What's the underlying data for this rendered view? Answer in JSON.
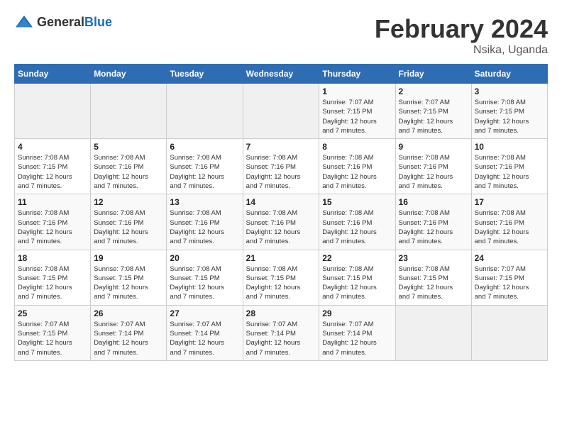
{
  "header": {
    "logo_general": "General",
    "logo_blue": "Blue",
    "title": "February 2024",
    "location": "Nsika, Uganda"
  },
  "days_of_week": [
    "Sunday",
    "Monday",
    "Tuesday",
    "Wednesday",
    "Thursday",
    "Friday",
    "Saturday"
  ],
  "weeks": [
    [
      {
        "day": "",
        "info": ""
      },
      {
        "day": "",
        "info": ""
      },
      {
        "day": "",
        "info": ""
      },
      {
        "day": "",
        "info": ""
      },
      {
        "day": "1",
        "info": "Sunrise: 7:07 AM\nSunset: 7:15 PM\nDaylight: 12 hours\nand 7 minutes."
      },
      {
        "day": "2",
        "info": "Sunrise: 7:07 AM\nSunset: 7:15 PM\nDaylight: 12 hours\nand 7 minutes."
      },
      {
        "day": "3",
        "info": "Sunrise: 7:08 AM\nSunset: 7:15 PM\nDaylight: 12 hours\nand 7 minutes."
      }
    ],
    [
      {
        "day": "4",
        "info": "Sunrise: 7:08 AM\nSunset: 7:15 PM\nDaylight: 12 hours\nand 7 minutes."
      },
      {
        "day": "5",
        "info": "Sunrise: 7:08 AM\nSunset: 7:16 PM\nDaylight: 12 hours\nand 7 minutes."
      },
      {
        "day": "6",
        "info": "Sunrise: 7:08 AM\nSunset: 7:16 PM\nDaylight: 12 hours\nand 7 minutes."
      },
      {
        "day": "7",
        "info": "Sunrise: 7:08 AM\nSunset: 7:16 PM\nDaylight: 12 hours\nand 7 minutes."
      },
      {
        "day": "8",
        "info": "Sunrise: 7:08 AM\nSunset: 7:16 PM\nDaylight: 12 hours\nand 7 minutes."
      },
      {
        "day": "9",
        "info": "Sunrise: 7:08 AM\nSunset: 7:16 PM\nDaylight: 12 hours\nand 7 minutes."
      },
      {
        "day": "10",
        "info": "Sunrise: 7:08 AM\nSunset: 7:16 PM\nDaylight: 12 hours\nand 7 minutes."
      }
    ],
    [
      {
        "day": "11",
        "info": "Sunrise: 7:08 AM\nSunset: 7:16 PM\nDaylight: 12 hours\nand 7 minutes."
      },
      {
        "day": "12",
        "info": "Sunrise: 7:08 AM\nSunset: 7:16 PM\nDaylight: 12 hours\nand 7 minutes."
      },
      {
        "day": "13",
        "info": "Sunrise: 7:08 AM\nSunset: 7:16 PM\nDaylight: 12 hours\nand 7 minutes."
      },
      {
        "day": "14",
        "info": "Sunrise: 7:08 AM\nSunset: 7:16 PM\nDaylight: 12 hours\nand 7 minutes."
      },
      {
        "day": "15",
        "info": "Sunrise: 7:08 AM\nSunset: 7:16 PM\nDaylight: 12 hours\nand 7 minutes."
      },
      {
        "day": "16",
        "info": "Sunrise: 7:08 AM\nSunset: 7:16 PM\nDaylight: 12 hours\nand 7 minutes."
      },
      {
        "day": "17",
        "info": "Sunrise: 7:08 AM\nSunset: 7:16 PM\nDaylight: 12 hours\nand 7 minutes."
      }
    ],
    [
      {
        "day": "18",
        "info": "Sunrise: 7:08 AM\nSunset: 7:15 PM\nDaylight: 12 hours\nand 7 minutes."
      },
      {
        "day": "19",
        "info": "Sunrise: 7:08 AM\nSunset: 7:15 PM\nDaylight: 12 hours\nand 7 minutes."
      },
      {
        "day": "20",
        "info": "Sunrise: 7:08 AM\nSunset: 7:15 PM\nDaylight: 12 hours\nand 7 minutes."
      },
      {
        "day": "21",
        "info": "Sunrise: 7:08 AM\nSunset: 7:15 PM\nDaylight: 12 hours\nand 7 minutes."
      },
      {
        "day": "22",
        "info": "Sunrise: 7:08 AM\nSunset: 7:15 PM\nDaylight: 12 hours\nand 7 minutes."
      },
      {
        "day": "23",
        "info": "Sunrise: 7:08 AM\nSunset: 7:15 PM\nDaylight: 12 hours\nand 7 minutes."
      },
      {
        "day": "24",
        "info": "Sunrise: 7:07 AM\nSunset: 7:15 PM\nDaylight: 12 hours\nand 7 minutes."
      }
    ],
    [
      {
        "day": "25",
        "info": "Sunrise: 7:07 AM\nSunset: 7:15 PM\nDaylight: 12 hours\nand 7 minutes."
      },
      {
        "day": "26",
        "info": "Sunrise: 7:07 AM\nSunset: 7:14 PM\nDaylight: 12 hours\nand 7 minutes."
      },
      {
        "day": "27",
        "info": "Sunrise: 7:07 AM\nSunset: 7:14 PM\nDaylight: 12 hours\nand 7 minutes."
      },
      {
        "day": "28",
        "info": "Sunrise: 7:07 AM\nSunset: 7:14 PM\nDaylight: 12 hours\nand 7 minutes."
      },
      {
        "day": "29",
        "info": "Sunrise: 7:07 AM\nSunset: 7:14 PM\nDaylight: 12 hours\nand 7 minutes."
      },
      {
        "day": "",
        "info": ""
      },
      {
        "day": "",
        "info": ""
      }
    ]
  ]
}
